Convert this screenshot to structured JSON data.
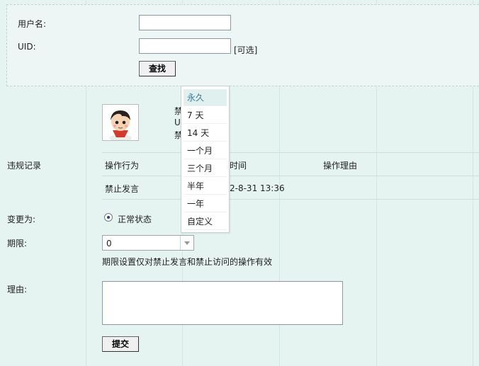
{
  "search": {
    "username_label": "用户名:",
    "username_value": "",
    "uid_label": "UID:",
    "uid_value": "",
    "optional_hint": "[可选]",
    "find_button": "查找"
  },
  "member": {
    "line1": "禁",
    "line2": "U",
    "line3": "禁"
  },
  "records": {
    "label": "违规记录",
    "headers": [
      "操作行为",
      "时间",
      "操作理由"
    ],
    "rows": [
      {
        "action": "禁止发言",
        "time": "2-8-31 13:36",
        "reason": ""
      }
    ]
  },
  "change": {
    "label": "变更为:",
    "option": "正常状态",
    "selected": true
  },
  "period": {
    "label": "期限:",
    "value": "0",
    "hint": "期限设置仅对禁止发言和禁止访问的操作有效",
    "options": [
      "永久",
      "7 天",
      "14 天",
      "一个月",
      "三个月",
      "半年",
      "一年",
      "自定义"
    ],
    "highlighted": 0
  },
  "reason": {
    "label": "理由:",
    "value": ""
  },
  "submit": {
    "label": "提交"
  }
}
